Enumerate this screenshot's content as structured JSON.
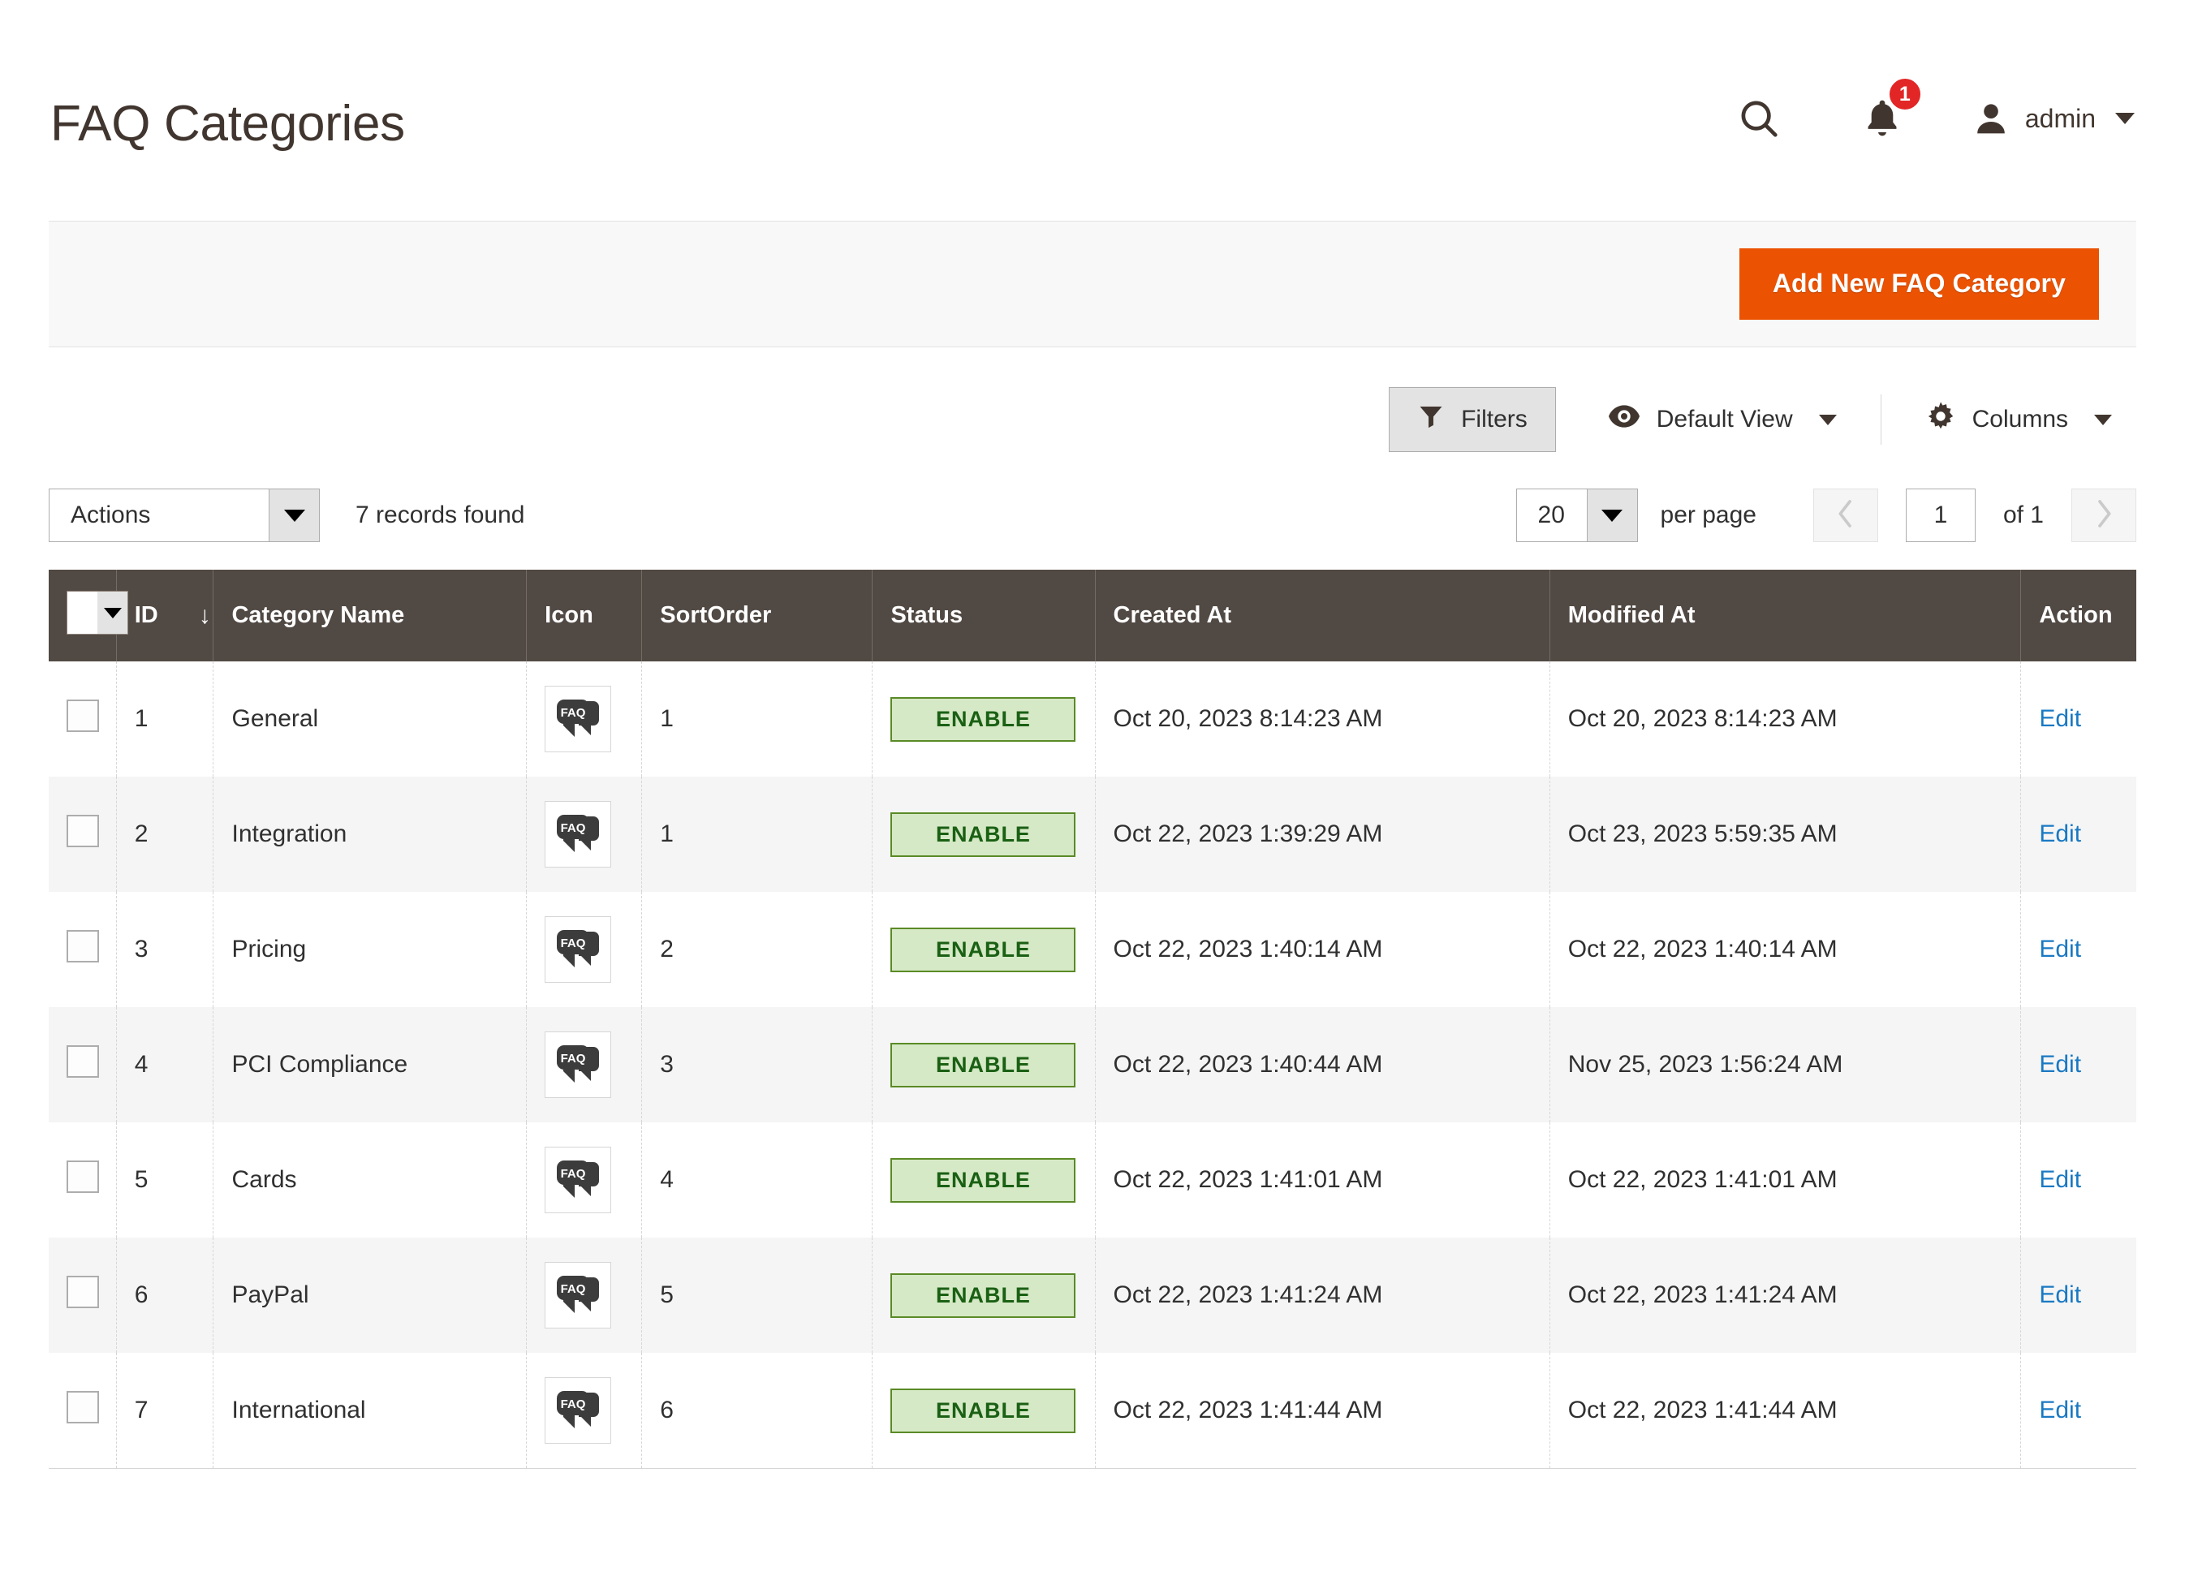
{
  "header": {
    "title": "FAQ Categories",
    "search_icon": "search-icon",
    "notifications_icon": "bell-icon",
    "notifications_count": "1",
    "user_name": "admin",
    "user_icon": "user-avatar-icon"
  },
  "action_bar": {
    "add_button_label": "Add New FAQ Category"
  },
  "grid_controls": {
    "filters_label": "Filters",
    "filters_icon": "funnel-icon",
    "view_label": "Default View",
    "view_icon": "eye-icon",
    "columns_label": "Columns",
    "columns_icon": "gear-icon"
  },
  "grid_subcontrols": {
    "actions_label": "Actions",
    "records_found": "7 records found",
    "per_page_value": "20",
    "per_page_label": "per page",
    "page_value": "1",
    "page_total_label": "of 1",
    "prev_icon": "chevron-left-icon",
    "next_icon": "chevron-right-icon"
  },
  "table": {
    "columns": {
      "id": "ID",
      "name": "Category Name",
      "icon": "Icon",
      "sort": "SortOrder",
      "status": "Status",
      "created": "Created At",
      "modified": "Modified At",
      "action": "Action"
    },
    "sort_indicator": "↓",
    "action_link_label": "Edit",
    "icon_label": "FAQ",
    "rows": [
      {
        "id": "1",
        "name": "General",
        "icon": "faq-bubble-icon",
        "sort": "1",
        "status": "ENABLE",
        "created": "Oct 20, 2023 8:14:23 AM",
        "modified": "Oct 20, 2023 8:14:23 AM",
        "action": "Edit"
      },
      {
        "id": "2",
        "name": "Integration",
        "icon": "faq-bubble-icon",
        "sort": "1",
        "status": "ENABLE",
        "created": "Oct 22, 2023 1:39:29 AM",
        "modified": "Oct 23, 2023 5:59:35 AM",
        "action": "Edit"
      },
      {
        "id": "3",
        "name": "Pricing",
        "icon": "faq-bubble-icon",
        "sort": "2",
        "status": "ENABLE",
        "created": "Oct 22, 2023 1:40:14 AM",
        "modified": "Oct 22, 2023 1:40:14 AM",
        "action": "Edit"
      },
      {
        "id": "4",
        "name": "PCI Compliance",
        "icon": "faq-bubble-icon",
        "sort": "3",
        "status": "ENABLE",
        "created": "Oct 22, 2023 1:40:44 AM",
        "modified": "Nov 25, 2023 1:56:24 AM",
        "action": "Edit"
      },
      {
        "id": "5",
        "name": "Cards",
        "icon": "faq-bubble-icon",
        "sort": "4",
        "status": "ENABLE",
        "created": "Oct 22, 2023 1:41:01 AM",
        "modified": "Oct 22, 2023 1:41:01 AM",
        "action": "Edit"
      },
      {
        "id": "6",
        "name": "PayPal",
        "icon": "faq-bubble-icon",
        "sort": "5",
        "status": "ENABLE",
        "created": "Oct 22, 2023 1:41:24 AM",
        "modified": "Oct 22, 2023 1:41:24 AM",
        "action": "Edit"
      },
      {
        "id": "7",
        "name": "International",
        "icon": "faq-bubble-icon",
        "sort": "6",
        "status": "ENABLE",
        "created": "Oct 22, 2023 1:41:44 AM",
        "modified": "Oct 22, 2023 1:41:44 AM",
        "action": "Edit"
      }
    ]
  },
  "colors": {
    "accent_orange": "#eb5202",
    "header_brown": "#514943",
    "link_blue": "#1979c3",
    "status_green_bg": "#d6e9c6",
    "status_green_border": "#5a8a26",
    "status_green_text": "#1a6014",
    "badge_red": "#e22626"
  }
}
